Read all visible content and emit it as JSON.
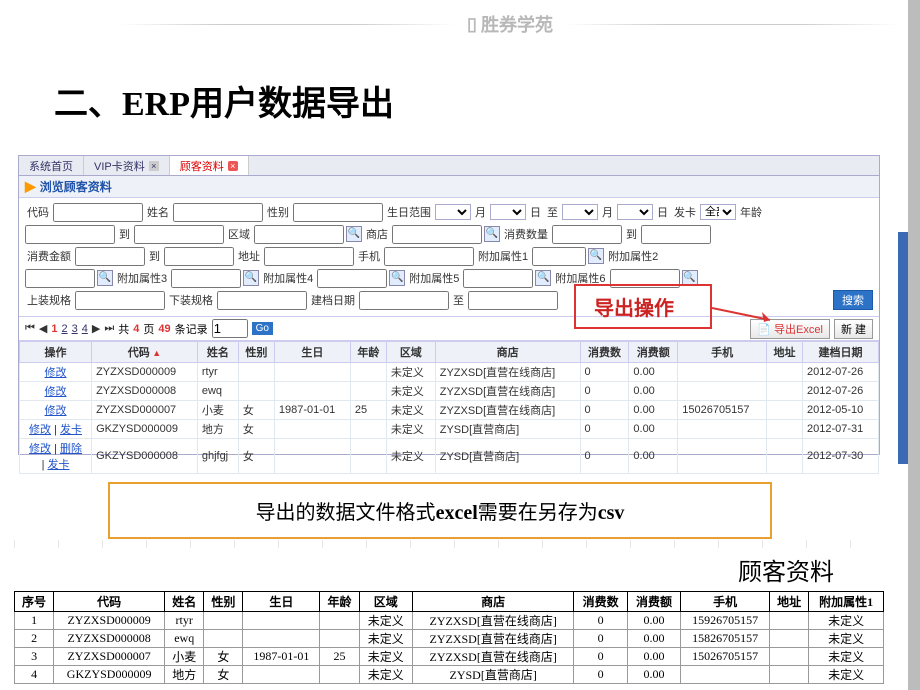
{
  "banner_text": "胜券学苑",
  "page_title": "二、ERP用户数据导出",
  "tabs": {
    "home": "系统首页",
    "vip": "VIP卡资料",
    "cust": "顾客资料"
  },
  "sub_title": "浏览顾客资料",
  "filters": {
    "code": "代码",
    "name": "姓名",
    "sex": "性别",
    "birth_range": "生日范围",
    "month": "月",
    "day": "日",
    "to": "至",
    "to2": "到",
    "issue": "发卡",
    "all": "全部",
    "age": "年龄",
    "region": "区域",
    "store": "商店",
    "consume_count": "消费数量",
    "consume_amount": "消费金额",
    "address": "地址",
    "phone": "手机",
    "attr1": "附加属性1",
    "attr2": "附加属性2",
    "attr3": "附加属性3",
    "attr4": "附加属性4",
    "attr5": "附加属性5",
    "attr6": "附加属性6",
    "spec_top": "上装规格",
    "spec_bottom": "下装规格",
    "build_date": "建档日期",
    "search_btn": "搜索"
  },
  "callout_text": "导出操作",
  "pagination": {
    "total_pages": "4",
    "total_records": "49",
    "page_label_prefix": "共",
    "page_label_mid": "页",
    "rec_label": "条记录",
    "go": "Go",
    "page_input": "1"
  },
  "action_buttons": {
    "export": "导出Excel",
    "new": "新 建"
  },
  "table_headers": [
    "操作",
    "代码",
    "姓名",
    "性别",
    "生日",
    "年龄",
    "区域",
    "商店",
    "消费数",
    "消费额",
    "手机",
    "地址",
    "建档日期"
  ],
  "ops": {
    "edit": "修改",
    "card": "发卡",
    "del": "删除"
  },
  "rows": [
    {
      "op": "edit",
      "code": "ZYZXSD000009",
      "name": "rtyr",
      "sex": "",
      "birth": "",
      "age": "",
      "region": "未定义",
      "store": "ZYZXSD[直营在线商店]",
      "cnt": "0",
      "amt": "0.00",
      "phone": "",
      "addr": "",
      "date": "2012-07-26"
    },
    {
      "op": "edit",
      "code": "ZYZXSD000008",
      "name": "ewq",
      "sex": "",
      "birth": "",
      "age": "",
      "region": "未定义",
      "store": "ZYZXSD[直营在线商店]",
      "cnt": "0",
      "amt": "0.00",
      "phone": "",
      "addr": "",
      "date": "2012-07-26"
    },
    {
      "op": "edit",
      "code": "ZYZXSD000007",
      "name": "小麦",
      "sex": "女",
      "birth": "1987-01-01",
      "age": "25",
      "region": "未定义",
      "store": "ZYZXSD[直营在线商店]",
      "cnt": "0",
      "amt": "0.00",
      "phone": "15026705157",
      "addr": "",
      "date": "2012-05-10"
    },
    {
      "op": "edit_card",
      "code": "GKZYSD000009",
      "name": "地方",
      "sex": "女",
      "birth": "",
      "age": "",
      "region": "未定义",
      "store": "ZYSD[直营商店]",
      "cnt": "0",
      "amt": "0.00",
      "phone": "",
      "addr": "",
      "date": "2012-07-31"
    },
    {
      "op": "edit_del_card",
      "code": "GKZYSD000008",
      "name": "ghjfgj",
      "sex": "女",
      "birth": "",
      "age": "",
      "region": "未定义",
      "store": "ZYSD[直营商店]",
      "cnt": "0",
      "amt": "0.00",
      "phone": "",
      "addr": "",
      "date": "2012-07-30"
    }
  ],
  "note": {
    "pre": "导出的数据文件格式",
    "b1": "excel",
    "mid": "需要在另存为",
    "b2": "csv"
  },
  "excel_title": "顾客资料",
  "excel_headers": [
    "序号",
    "代码",
    "姓名",
    "性别",
    "生日",
    "年龄",
    "区域",
    "商店",
    "消费数",
    "消费额",
    "手机",
    "地址",
    "附加属性1"
  ],
  "excel_rows": [
    {
      "n": "1",
      "code": "ZYZXSD000009",
      "name": "rtyr",
      "sex": "",
      "birth": "",
      "age": "",
      "region": "未定义",
      "store": "ZYZXSD[直营在线商店]",
      "cnt": "0",
      "amt": "0.00",
      "phone": "15926705157",
      "addr": "",
      "a1": "未定义"
    },
    {
      "n": "2",
      "code": "ZYZXSD000008",
      "name": "ewq",
      "sex": "",
      "birth": "",
      "age": "",
      "region": "未定义",
      "store": "ZYZXSD[直营在线商店]",
      "cnt": "0",
      "amt": "0.00",
      "phone": "15826705157",
      "addr": "",
      "a1": "未定义"
    },
    {
      "n": "3",
      "code": "ZYZXSD000007",
      "name": "小麦",
      "sex": "女",
      "birth": "1987-01-01",
      "age": "25",
      "region": "未定义",
      "store": "ZYZXSD[直营在线商店]",
      "cnt": "0",
      "amt": "0.00",
      "phone": "15026705157",
      "addr": "",
      "a1": "未定义"
    },
    {
      "n": "4",
      "code": "GKZYSD000009",
      "name": "地方",
      "sex": "女",
      "birth": "",
      "age": "",
      "region": "未定义",
      "store": "ZYSD[直营商店]",
      "cnt": "0",
      "amt": "0.00",
      "phone": "",
      "addr": "",
      "a1": "未定义"
    }
  ]
}
